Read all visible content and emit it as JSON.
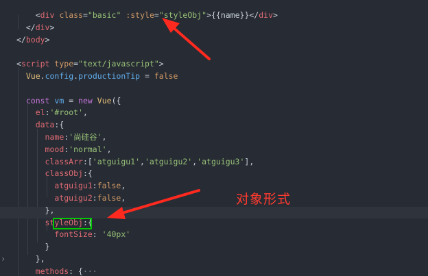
{
  "annotation": {
    "text": "对象形式",
    "color": "#ff3b30"
  },
  "highlight": {
    "text": "fontSize",
    "color": "#00c800"
  },
  "code": {
    "lines": [
      {
        "parts": [
          {
            "c": "t-plain",
            "t": "    "
          },
          {
            "c": "t-plain",
            "t": "<"
          },
          {
            "c": "t-tag",
            "t": "div"
          },
          {
            "c": "t-plain",
            "t": " "
          },
          {
            "c": "t-attr",
            "t": "class"
          },
          {
            "c": "t-plain",
            "t": "="
          },
          {
            "c": "t-str",
            "t": "\"basic\""
          },
          {
            "c": "t-plain",
            "t": " "
          },
          {
            "c": "t-attr",
            "t": ":style"
          },
          {
            "c": "t-plain",
            "t": "="
          },
          {
            "c": "t-str",
            "t": "\"styleObj\""
          },
          {
            "c": "t-plain",
            "t": ">{{name}}</"
          },
          {
            "c": "t-tag",
            "t": "div"
          },
          {
            "c": "t-plain",
            "t": ">"
          }
        ]
      },
      {
        "parts": [
          {
            "c": "t-plain",
            "t": "  </"
          },
          {
            "c": "t-tag",
            "t": "div"
          },
          {
            "c": "t-plain",
            "t": ">"
          }
        ]
      },
      {
        "parts": [
          {
            "c": "t-plain",
            "t": "</"
          },
          {
            "c": "t-tag",
            "t": "body"
          },
          {
            "c": "t-plain",
            "t": ">"
          }
        ]
      },
      {
        "parts": []
      },
      {
        "parts": [
          {
            "c": "t-plain",
            "t": "<"
          },
          {
            "c": "t-tag",
            "t": "script"
          },
          {
            "c": "t-plain",
            "t": " "
          },
          {
            "c": "t-attr",
            "t": "type"
          },
          {
            "c": "t-plain",
            "t": "="
          },
          {
            "c": "t-str",
            "t": "\"text/javascript\""
          },
          {
            "c": "t-plain",
            "t": ">"
          }
        ]
      },
      {
        "parts": [
          {
            "c": "t-plain",
            "t": "  "
          },
          {
            "c": "t-prop",
            "t": "Vue"
          },
          {
            "c": "t-plain",
            "t": "."
          },
          {
            "c": "t-fn",
            "t": "config"
          },
          {
            "c": "t-plain",
            "t": "."
          },
          {
            "c": "t-fn",
            "t": "productionTip"
          },
          {
            "c": "t-plain",
            "t": " = "
          },
          {
            "c": "t-num",
            "t": "false"
          }
        ]
      },
      {
        "parts": []
      },
      {
        "parts": [
          {
            "c": "t-plain",
            "t": "  "
          },
          {
            "c": "t-kw",
            "t": "const"
          },
          {
            "c": "t-plain",
            "t": " "
          },
          {
            "c": "t-fn",
            "t": "vm"
          },
          {
            "c": "t-plain",
            "t": " = "
          },
          {
            "c": "t-kw",
            "t": "new"
          },
          {
            "c": "t-plain",
            "t": " "
          },
          {
            "c": "t-prop",
            "t": "Vue"
          },
          {
            "c": "t-plain",
            "t": "({"
          }
        ]
      },
      {
        "parts": [
          {
            "c": "t-plain",
            "t": "    "
          },
          {
            "c": "t-tag",
            "t": "el"
          },
          {
            "c": "t-plain",
            "t": ":"
          },
          {
            "c": "t-str",
            "t": "'#root'"
          },
          {
            "c": "t-plain",
            "t": ","
          }
        ]
      },
      {
        "parts": [
          {
            "c": "t-plain",
            "t": "    "
          },
          {
            "c": "t-tag",
            "t": "data"
          },
          {
            "c": "t-plain",
            "t": ":{"
          }
        ]
      },
      {
        "parts": [
          {
            "c": "t-plain",
            "t": "      "
          },
          {
            "c": "t-tag",
            "t": "name"
          },
          {
            "c": "t-plain",
            "t": ":"
          },
          {
            "c": "t-str",
            "t": "'尚硅谷'"
          },
          {
            "c": "t-plain",
            "t": ","
          }
        ]
      },
      {
        "parts": [
          {
            "c": "t-plain",
            "t": "      "
          },
          {
            "c": "t-tag",
            "t": "mood"
          },
          {
            "c": "t-plain",
            "t": ":"
          },
          {
            "c": "t-str",
            "t": "'normal'"
          },
          {
            "c": "t-plain",
            "t": ","
          }
        ]
      },
      {
        "parts": [
          {
            "c": "t-plain",
            "t": "      "
          },
          {
            "c": "t-tag",
            "t": "classArr"
          },
          {
            "c": "t-plain",
            "t": ":["
          },
          {
            "c": "t-str",
            "t": "'atguigu1'"
          },
          {
            "c": "t-plain",
            "t": ","
          },
          {
            "c": "t-str",
            "t": "'atguigu2'"
          },
          {
            "c": "t-plain",
            "t": ","
          },
          {
            "c": "t-str",
            "t": "'atguigu3'"
          },
          {
            "c": "t-plain",
            "t": "],"
          }
        ]
      },
      {
        "parts": [
          {
            "c": "t-plain",
            "t": "      "
          },
          {
            "c": "t-tag",
            "t": "classObj"
          },
          {
            "c": "t-plain",
            "t": ":{"
          }
        ]
      },
      {
        "parts": [
          {
            "c": "t-plain",
            "t": "        "
          },
          {
            "c": "t-tag",
            "t": "atguigu1"
          },
          {
            "c": "t-plain",
            "t": ":"
          },
          {
            "c": "t-num",
            "t": "false"
          },
          {
            "c": "t-plain",
            "t": ","
          }
        ]
      },
      {
        "parts": [
          {
            "c": "t-plain",
            "t": "        "
          },
          {
            "c": "t-tag",
            "t": "atguigu2"
          },
          {
            "c": "t-plain",
            "t": ":"
          },
          {
            "c": "t-num",
            "t": "false"
          },
          {
            "c": "t-plain",
            "t": ","
          }
        ]
      },
      {
        "parts": [
          {
            "c": "t-plain",
            "t": "      },"
          }
        ]
      },
      {
        "parts": [
          {
            "c": "t-plain",
            "t": "      "
          },
          {
            "c": "t-tag",
            "t": "styleObj"
          },
          {
            "c": "t-plain",
            "t": ":{"
          }
        ]
      },
      {
        "parts": [
          {
            "c": "t-plain",
            "t": "        "
          },
          {
            "c": "t-tag",
            "t": "fontSize"
          },
          {
            "c": "t-plain",
            "t": ": "
          },
          {
            "c": "t-str",
            "t": "'40px'"
          }
        ]
      },
      {
        "parts": [
          {
            "c": "t-plain",
            "t": "      }"
          }
        ]
      },
      {
        "parts": [
          {
            "c": "t-plain",
            "t": "    },"
          }
        ]
      },
      {
        "parts": [
          {
            "c": "t-plain",
            "t": "    "
          },
          {
            "c": "t-tag",
            "t": "methods"
          },
          {
            "c": "t-plain",
            "t": ": {"
          },
          {
            "c": "t-muted",
            "t": "···"
          }
        ]
      },
      {
        "parts": [
          {
            "c": "t-plain",
            "t": "  })"
          }
        ]
      }
    ]
  }
}
